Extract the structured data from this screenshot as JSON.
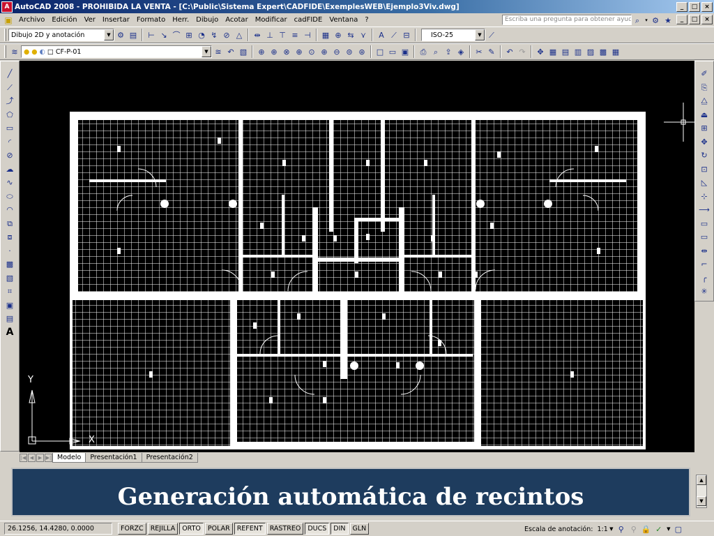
{
  "window": {
    "title": "AutoCAD 2008 - PROHIBIDA LA VENTA - [C:\\Public\\Sistema Expert\\CADFIDE\\ExemplesWEB\\Ejemplo3Viv.dwg]",
    "buttons": [
      "_",
      "□",
      "×"
    ]
  },
  "menu": {
    "items": [
      "Archivo",
      "Edición",
      "Ver",
      "Insertar",
      "Formato",
      "Herr.",
      "Dibujo",
      "Acotar",
      "Modificar",
      "cadFIDE",
      "Ventana",
      "?"
    ],
    "help_placeholder": "Escriba una pregunta para obtener ayuda"
  },
  "toolbar1": {
    "workspace": "Dibujo 2D y anotación",
    "dimstyle": "ISO-25"
  },
  "toolbar2": {
    "layer": "CF-P-01"
  },
  "tabs": [
    "Modelo",
    "Presentación1",
    "Presentación2"
  ],
  "ucs": {
    "y_label": "Y",
    "x_label": "X"
  },
  "banner": "Generación automática de recintos",
  "status": {
    "coordinates": "26.1256, 14.4280, 0.0000",
    "modes": [
      "FORZC",
      "REJILLA",
      "ORTO",
      "POLAR",
      "REFENT",
      "RASTREO",
      "DUCS",
      "DIN",
      "GLN"
    ],
    "modes_on": [
      "ORTO",
      "REFENT",
      "DUCS",
      "DIN"
    ],
    "scale_label": "Escala de anotación:",
    "scale_value": "1:1"
  },
  "colors": {
    "title_bar": "#0a246a",
    "canvas_bg": "#000000",
    "drawing_lines": "#ffffff",
    "banner_bg": "#1e3c5e"
  }
}
